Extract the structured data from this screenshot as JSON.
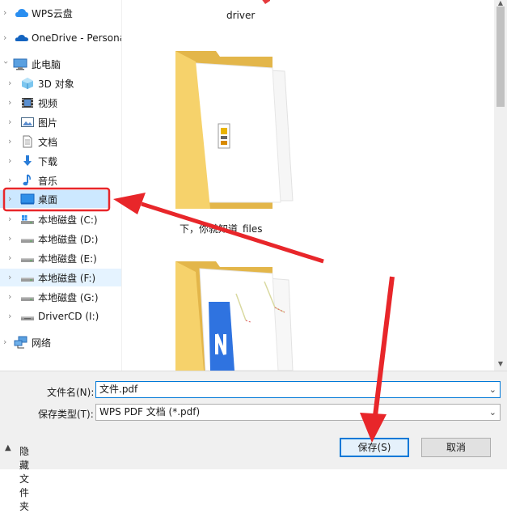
{
  "nav_tree": {
    "items": [
      {
        "label": "WPS云盘",
        "icon": "cloud-icon"
      },
      {
        "label": "OneDrive - Persona",
        "icon": "onedrive-icon"
      },
      {
        "label": "此电脑",
        "icon": "computer-icon"
      },
      {
        "label": "3D 对象",
        "icon": "3d-objects-icon"
      },
      {
        "label": "视频",
        "icon": "video-icon"
      },
      {
        "label": "图片",
        "icon": "pictures-icon"
      },
      {
        "label": "文档",
        "icon": "documents-icon"
      },
      {
        "label": "下载",
        "icon": "download-icon"
      },
      {
        "label": "音乐",
        "icon": "music-icon"
      },
      {
        "label": "桌面",
        "icon": "desktop-icon"
      },
      {
        "label": "本地磁盘 (C:)",
        "icon": "drive-c-icon"
      },
      {
        "label": "本地磁盘 (D:)",
        "icon": "drive-icon"
      },
      {
        "label": "本地磁盘 (E:)",
        "icon": "drive-icon"
      },
      {
        "label": "本地磁盘 (F:)",
        "icon": "drive-icon"
      },
      {
        "label": "本地磁盘 (G:)",
        "icon": "drive-icon"
      },
      {
        "label": "DriverCD (I:)",
        "icon": "cd-drive-icon"
      },
      {
        "label": "网络",
        "icon": "network-icon"
      }
    ]
  },
  "files": {
    "items": [
      {
        "label": "driver",
        "icon": "folder-icon"
      },
      {
        "label": "下，你就知道_files",
        "icon": "folder-icon"
      },
      {
        "label": "",
        "icon": "folder-icon"
      }
    ]
  },
  "form": {
    "filename_label": "文件名(N):",
    "filename_value": "文件.pdf",
    "filetype_label": "保存类型(T):",
    "filetype_value": "WPS PDF 文档 (*.pdf)"
  },
  "footer": {
    "hide_folders_label": "隐藏文件夹",
    "save_label": "保存(S)",
    "cancel_label": "取消"
  },
  "colors": {
    "selection": "#cce8ff",
    "annotation_red": "#e8262a",
    "primary_border": "#0078d7",
    "folder_yellow": "#f6d26b"
  }
}
